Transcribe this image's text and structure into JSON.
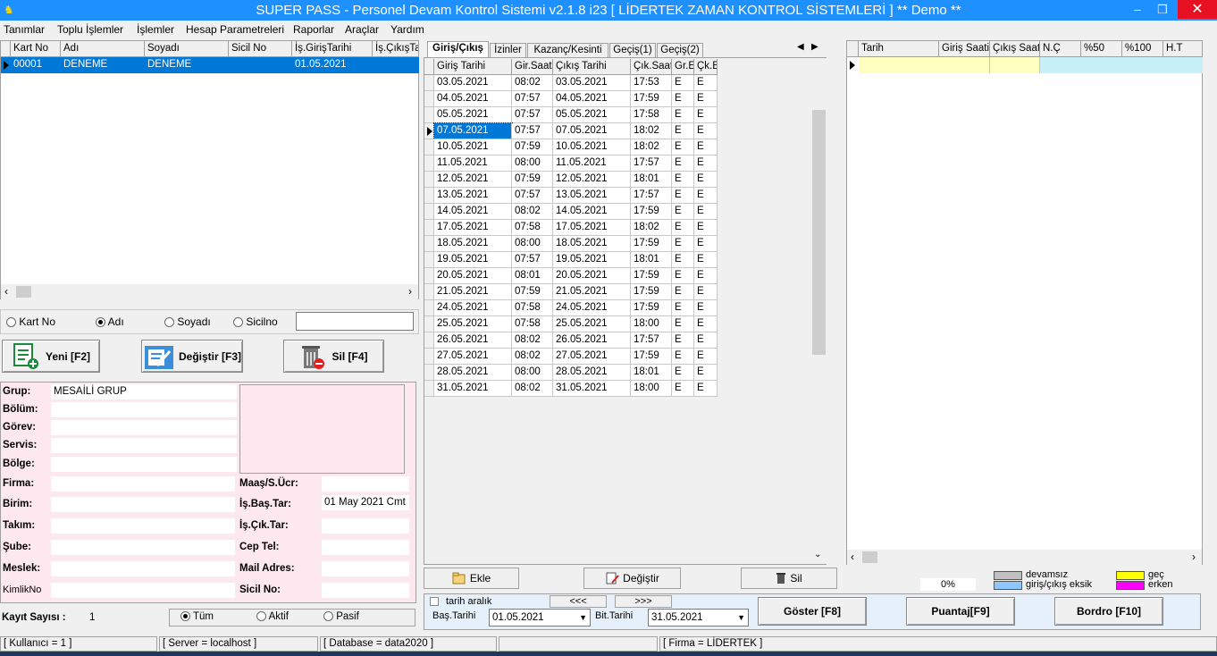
{
  "window": {
    "title": "SUPER PASS - Personel Devam Kontrol Sistemi v2.1.8 i23 [ LİDERTEK ZAMAN KONTROL  SİSTEMLERİ ]    ** Demo **",
    "minimize": "–",
    "restore": "❐",
    "close": "✕"
  },
  "menu": [
    "Tanımlar",
    "Toplu İşlemler",
    "İşlemler",
    "Hesap Parametreleri",
    "Raporlar",
    "Araçlar",
    "Yardım"
  ],
  "employee_grid": {
    "headers": [
      "Kart No",
      "Adı",
      "Soyadı",
      "Sicil No",
      "İş.GirişTarihi",
      "İş.ÇıkışTa"
    ],
    "rows": [
      [
        "00001",
        "DENEME",
        "DENEME",
        "",
        "01.05.2021",
        ""
      ]
    ]
  },
  "search": {
    "options": [
      "Kart No",
      "Adı",
      "Soyadı",
      "Sicilno"
    ],
    "selected": "Adı",
    "value": ""
  },
  "actions": {
    "new": "Yeni [F2]",
    "edit": "Değiştir [F3]",
    "delete": "Sil [F4]"
  },
  "details": {
    "labels": {
      "grup": "Grup:",
      "bolum": "Bölüm:",
      "gorev": "Görev:",
      "servis": "Servis:",
      "bolge": "Bölge:",
      "firma": "Firma:",
      "birim": "Birim:",
      "takim": "Takım:",
      "sube": "Şube:",
      "meslek": "Meslek:",
      "kimlik": "KimlikNo",
      "maas": "Maaş/S.Ücr:",
      "is_bas": "İş.Baş.Tar:",
      "is_cik": "İş.Çık.Tar:",
      "cep": "Cep Tel:",
      "mail": "Mail Adres:",
      "sicil": "Sicil No:"
    },
    "values": {
      "grup": "MESAİLİ GRUP",
      "is_bas": "01 May 2021 Cmt"
    }
  },
  "record_count": {
    "label": "Kayıt Sayısı :",
    "value": "1"
  },
  "status_filter": {
    "options": [
      "Tüm",
      "Aktif",
      "Pasif"
    ],
    "selected": "Tüm"
  },
  "tabs": [
    "Giriş/Çıkış",
    "İzinler",
    "Kazanç/Kesinti",
    "Geçiş(1)",
    "Geçiş(2)"
  ],
  "active_tab": "Giriş/Çıkış",
  "attendance": {
    "headers": [
      "Giriş Tarihi",
      "Gir.Saati",
      "Çıkış Tarihi",
      "Çık.Saati",
      "Gr.E",
      "Çk.E"
    ],
    "rows": [
      [
        "03.05.2021",
        "08:02",
        "03.05.2021",
        "17:53",
        "E",
        "E"
      ],
      [
        "04.05.2021",
        "07:57",
        "04.05.2021",
        "17:59",
        "E",
        "E"
      ],
      [
        "05.05.2021",
        "07:57",
        "05.05.2021",
        "17:58",
        "E",
        "E"
      ],
      [
        "07.05.2021",
        "07:57",
        "07.05.2021",
        "18:02",
        "E",
        "E"
      ],
      [
        "10.05.2021",
        "07:59",
        "10.05.2021",
        "18:02",
        "E",
        "E"
      ],
      [
        "11.05.2021",
        "08:00",
        "11.05.2021",
        "17:57",
        "E",
        "E"
      ],
      [
        "12.05.2021",
        "07:59",
        "12.05.2021",
        "18:01",
        "E",
        "E"
      ],
      [
        "13.05.2021",
        "07:57",
        "13.05.2021",
        "17:57",
        "E",
        "E"
      ],
      [
        "14.05.2021",
        "08:02",
        "14.05.2021",
        "17:59",
        "E",
        "E"
      ],
      [
        "17.05.2021",
        "07:58",
        "17.05.2021",
        "18:02",
        "E",
        "E"
      ],
      [
        "18.05.2021",
        "08:00",
        "18.05.2021",
        "17:59",
        "E",
        "E"
      ],
      [
        "19.05.2021",
        "07:57",
        "19.05.2021",
        "18:01",
        "E",
        "E"
      ],
      [
        "20.05.2021",
        "08:01",
        "20.05.2021",
        "17:59",
        "E",
        "E"
      ],
      [
        "21.05.2021",
        "07:59",
        "21.05.2021",
        "17:59",
        "E",
        "E"
      ],
      [
        "24.05.2021",
        "07:58",
        "24.05.2021",
        "17:59",
        "E",
        "E"
      ],
      [
        "25.05.2021",
        "07:58",
        "25.05.2021",
        "18:00",
        "E",
        "E"
      ],
      [
        "26.05.2021",
        "08:02",
        "26.05.2021",
        "17:57",
        "E",
        "E"
      ],
      [
        "27.05.2021",
        "08:02",
        "27.05.2021",
        "17:59",
        "E",
        "E"
      ],
      [
        "28.05.2021",
        "08:00",
        "28.05.2021",
        "18:01",
        "E",
        "E"
      ],
      [
        "31.05.2021",
        "08:02",
        "31.05.2021",
        "18:00",
        "E",
        "E"
      ]
    ],
    "selected_row": 3
  },
  "summary_grid": {
    "headers": [
      "Tarih",
      "Giriş Saati",
      "Çıkış Saati",
      "N.Ç",
      "%50",
      "%100",
      "H.T"
    ]
  },
  "mid_actions": {
    "add": "Ekle",
    "edit": "Değiştir",
    "delete": "Sil"
  },
  "progress": "0%",
  "legend": [
    {
      "label": "devamsız",
      "color": "#c0c0c0"
    },
    {
      "label": "giriş/çıkış eksik",
      "color": "#8ec8ff"
    },
    {
      "label": "geç",
      "color": "#ffff00"
    },
    {
      "label": "erken",
      "color": "#ff00ff"
    }
  ],
  "date_filter": {
    "range_label": "tarih aralık",
    "prev": "<<<",
    "next": ">>>",
    "start_label": "Baş.Tarihi",
    "start": "01.05.2021",
    "end_label": "Bit.Tarihi",
    "end": "31.05.2021"
  },
  "bottom_actions": {
    "show": "Göster [F8]",
    "puantaj": "Puantaj[F9]",
    "bordro": "Bordro [F10]"
  },
  "statusbar": [
    "[ Kullanıcı = 1 ]",
    "[ Server = localhost ]",
    "[ Database = data2020 ]",
    "",
    "[ Firma = LİDERTEK ]"
  ]
}
